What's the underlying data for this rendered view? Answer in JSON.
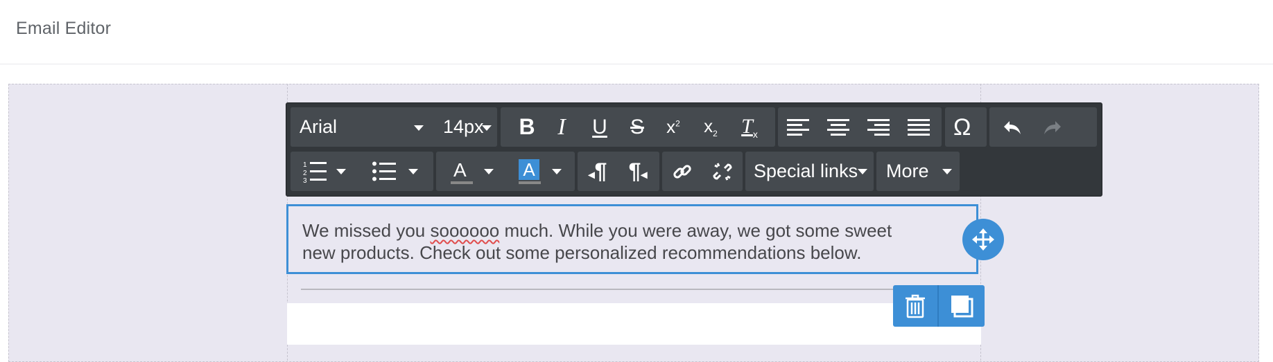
{
  "header": {
    "title": "Email Editor"
  },
  "toolbar": {
    "font_family": "Arial",
    "font_size": "14px",
    "special_links_label": "Special links",
    "more_label": "More",
    "icons": [
      "bold-icon",
      "italic-icon",
      "underline-icon",
      "strikethrough-icon",
      "superscript-icon",
      "subscript-icon",
      "clear-formatting-icon",
      "align-left-icon",
      "align-center-icon",
      "align-right-icon",
      "align-justify-icon",
      "special-character-icon",
      "undo-icon",
      "redo-icon",
      "ordered-list-icon",
      "unordered-list-icon",
      "text-color-icon",
      "background-color-icon",
      "ltr-paragraph-icon",
      "rtl-paragraph-icon",
      "insert-link-icon",
      "unlink-icon"
    ],
    "letters": {
      "bold": "B",
      "italic": "I",
      "underline": "U",
      "strike": "S",
      "omega": "Ω",
      "text_color": "A",
      "bg_color": "A",
      "pilcrow": "¶",
      "superscript_base": "x",
      "superscript_mark": "2",
      "subscript_base": "x",
      "subscript_mark": "2",
      "clear_base": "T",
      "clear_mark": "x"
    }
  },
  "content": {
    "line1_before": "We missed you ",
    "line1_misspelled": "soooooo",
    "line1_after": " much. While you were away, we got some sweet",
    "line2": "new products. Check out some personalized recommendations below."
  },
  "colors": {
    "accent": "#3d8fd6",
    "toolbar_bg": "#33373b",
    "toolbar_group": "#454a4f",
    "canvas_bg": "#e9e7f1",
    "text_color_bar": "#888888",
    "bg_color_highlight": "#3d8fd6"
  }
}
